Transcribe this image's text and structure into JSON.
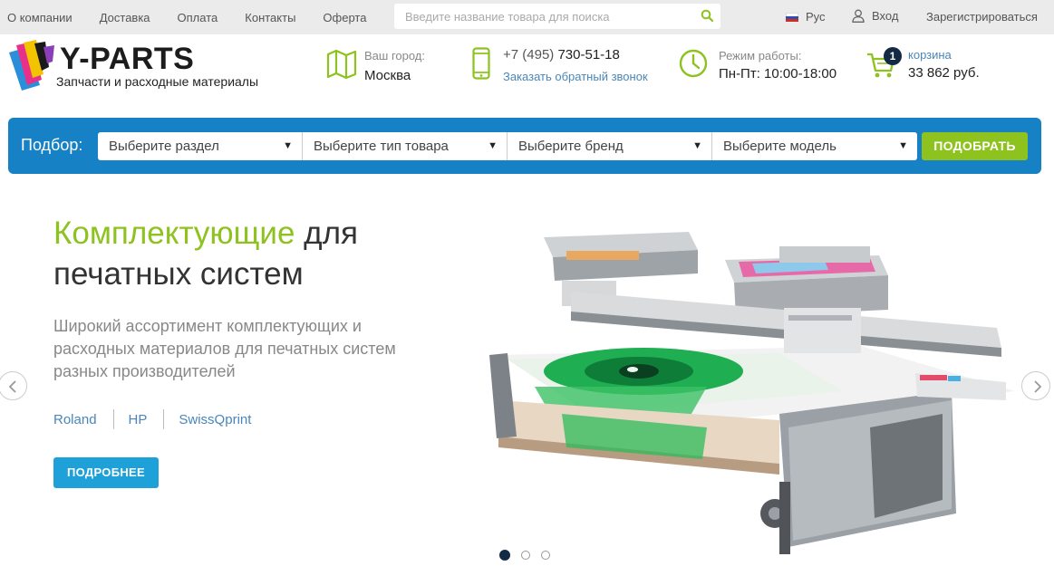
{
  "topnav": {
    "items": [
      "О компании",
      "Доставка",
      "Оплата",
      "Контакты",
      "Оферта"
    ]
  },
  "search": {
    "placeholder": "Введите название товара для поиска"
  },
  "lang": {
    "label": "Рус"
  },
  "auth": {
    "login": "Вход",
    "register": "Зарегистрироваться"
  },
  "logo": {
    "title": "Y-PARTS",
    "subtitle": "Запчасти и расходные материалы"
  },
  "city": {
    "label": "Ваш город:",
    "value": "Москва"
  },
  "phone": {
    "prefix": "+7 (495) ",
    "number": "730-51-18",
    "callback": "Заказать обратный звонок"
  },
  "hours": {
    "label": "Режим работы:",
    "value": "Пн-Пт: 10:00-18:00"
  },
  "cart": {
    "count": "1",
    "label": "корзина",
    "total": "33 862 руб."
  },
  "filter": {
    "label": "Подбор:",
    "selects": [
      "Выберите раздел",
      "Выберите тип товара",
      "Выберите бренд",
      "Выберите модель"
    ],
    "button": "ПОДОБРАТЬ"
  },
  "hero": {
    "title_accent": "Комплектующие",
    "title_rest": " для печатных систем",
    "description": "Широкий ассортимент комплектующих и расходных материалов для печатных систем разных производителей",
    "brands": [
      "Roland",
      "HP",
      "SwissQprint"
    ],
    "button": "ПОДРОБНЕЕ"
  },
  "colors": {
    "accent_green": "#8dc21f",
    "filter_blue": "#1781c5",
    "button_blue": "#1ea0d8",
    "dark_navy": "#132a44",
    "link_blue": "#4a86b8"
  },
  "icons": {
    "search": "search-icon",
    "flag": "russia-flag-icon",
    "user": "user-icon",
    "map": "map-icon",
    "phone": "mobile-phone-icon",
    "clock": "clock-icon",
    "cart": "cart-icon"
  }
}
